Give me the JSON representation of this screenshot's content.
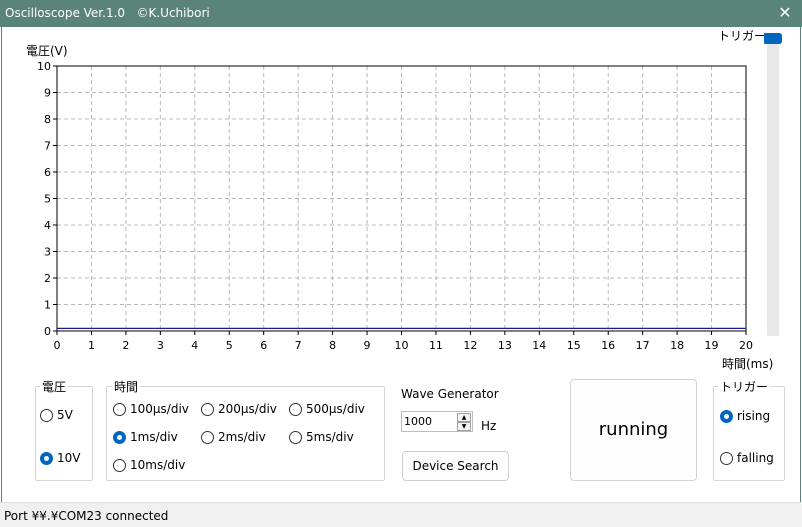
{
  "window": {
    "title": "Oscilloscope Ver.1.0   ©K.Uchibori",
    "close_glyph": "✕"
  },
  "scope": {
    "y_axis_label": "電圧(V)",
    "x_axis_label": "時間(ms)",
    "trigger_label": "トリガー"
  },
  "chart_data": {
    "type": "line",
    "xlabel": "時間(ms)",
    "ylabel": "電圧(V)",
    "xlim": [
      0,
      20
    ],
    "ylim": [
      0,
      10
    ],
    "x_ticks": [
      "0",
      "1",
      "2",
      "3",
      "4",
      "5",
      "6",
      "7",
      "8",
      "9",
      "10",
      "11",
      "12",
      "13",
      "14",
      "15",
      "16",
      "17",
      "18",
      "19",
      "20"
    ],
    "y_ticks": [
      "0",
      "1",
      "2",
      "3",
      "4",
      "5",
      "6",
      "7",
      "8",
      "9",
      "10"
    ],
    "grid": true,
    "grid_style": "dashed",
    "series": [
      {
        "color": "#1a1aa0",
        "x": [
          0,
          20
        ],
        "y": [
          0.1,
          0.1
        ]
      }
    ]
  },
  "trigger_slider": {
    "level": 1.0
  },
  "voltage_group": {
    "label": "電圧",
    "options": [
      {
        "label": "5V",
        "checked": false
      },
      {
        "label": "10V",
        "checked": true
      }
    ]
  },
  "time_group": {
    "label": "時間",
    "options": [
      {
        "label": "100µs/div",
        "checked": false
      },
      {
        "label": "200µs/div",
        "checked": false
      },
      {
        "label": "500µs/div",
        "checked": false
      },
      {
        "label": "1ms/div",
        "checked": true
      },
      {
        "label": "2ms/div",
        "checked": false
      },
      {
        "label": "5ms/div",
        "checked": false
      },
      {
        "label": "10ms/div",
        "checked": false
      }
    ]
  },
  "wave_generator": {
    "label": "Wave Generator",
    "frequency_value": "1000",
    "unit": "Hz",
    "device_search_label": "Device Search"
  },
  "run_button": {
    "label": "running"
  },
  "trigger_group": {
    "label": "トリガー",
    "options": [
      {
        "label": "rising",
        "checked": true
      },
      {
        "label": "falling",
        "checked": false
      }
    ]
  },
  "statusbar": {
    "text": "Port ¥¥.¥COM23 connected"
  },
  "colors": {
    "titlebar": "#5b8478",
    "accent": "#0067c0",
    "trace": "#1a1aa0"
  }
}
